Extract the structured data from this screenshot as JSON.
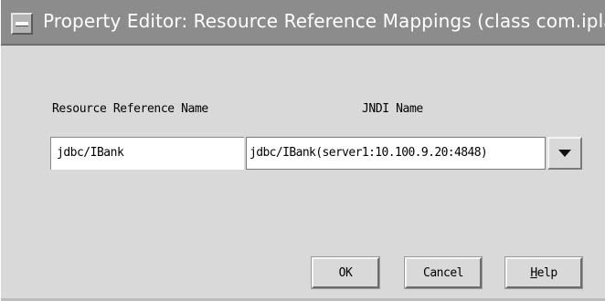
{
  "window": {
    "title": "Property Editor: Resource Reference Mappings (class com.ipla"
  },
  "form": {
    "resource_ref_label": "Resource Reference Name",
    "jndi_label": "JNDI Name",
    "resource_ref_value": "jdbc/IBank",
    "jndi_value": "jdbc/IBank(server1:10.100.9.20:4848)"
  },
  "buttons": {
    "ok": "OK",
    "cancel": "Cancel",
    "help_mnemonic": "H",
    "help_rest": "elp"
  },
  "icons": {
    "system_menu": "window-menu-icon",
    "dropdown": "chevron-down-icon"
  }
}
